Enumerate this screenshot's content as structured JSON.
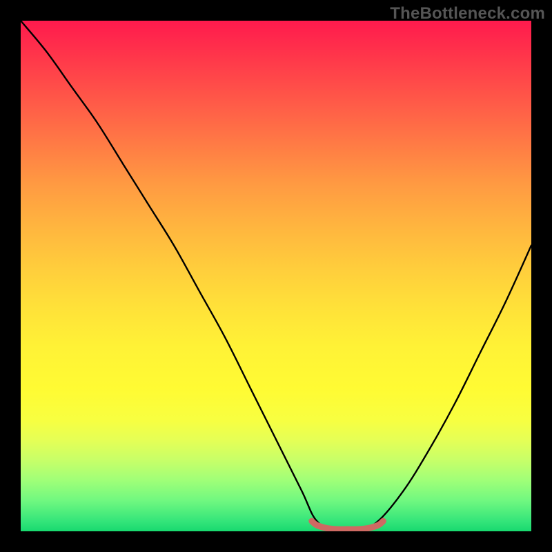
{
  "watermark": "TheBottleneck.com",
  "chart_data": {
    "type": "line",
    "title": "",
    "xlabel": "",
    "ylabel": "",
    "xlim": [
      0,
      100
    ],
    "ylim": [
      0,
      100
    ],
    "grid": false,
    "legend": false,
    "colors": {
      "curve": "#000000",
      "marker": "#cf6a63",
      "gradient_top": "#ff1a4d",
      "gradient_bottom": "#18d96f"
    },
    "series": [
      {
        "name": "bottleneck-curve",
        "x": [
          0,
          5,
          10,
          15,
          20,
          25,
          30,
          35,
          40,
          45,
          50,
          55,
          58,
          62,
          66,
          70,
          75,
          80,
          85,
          90,
          95,
          100
        ],
        "values": [
          100,
          94,
          87,
          80,
          72,
          64,
          56,
          47,
          38,
          28,
          18,
          8,
          2,
          0,
          0,
          2,
          8,
          16,
          25,
          35,
          45,
          56
        ]
      }
    ],
    "marker": {
      "name": "optimal-range",
      "x": [
        57,
        58,
        60,
        62,
        64,
        66,
        68,
        70,
        71
      ],
      "values": [
        2.0,
        1.2,
        0.6,
        0.4,
        0.4,
        0.4,
        0.6,
        1.2,
        2.0
      ]
    }
  }
}
